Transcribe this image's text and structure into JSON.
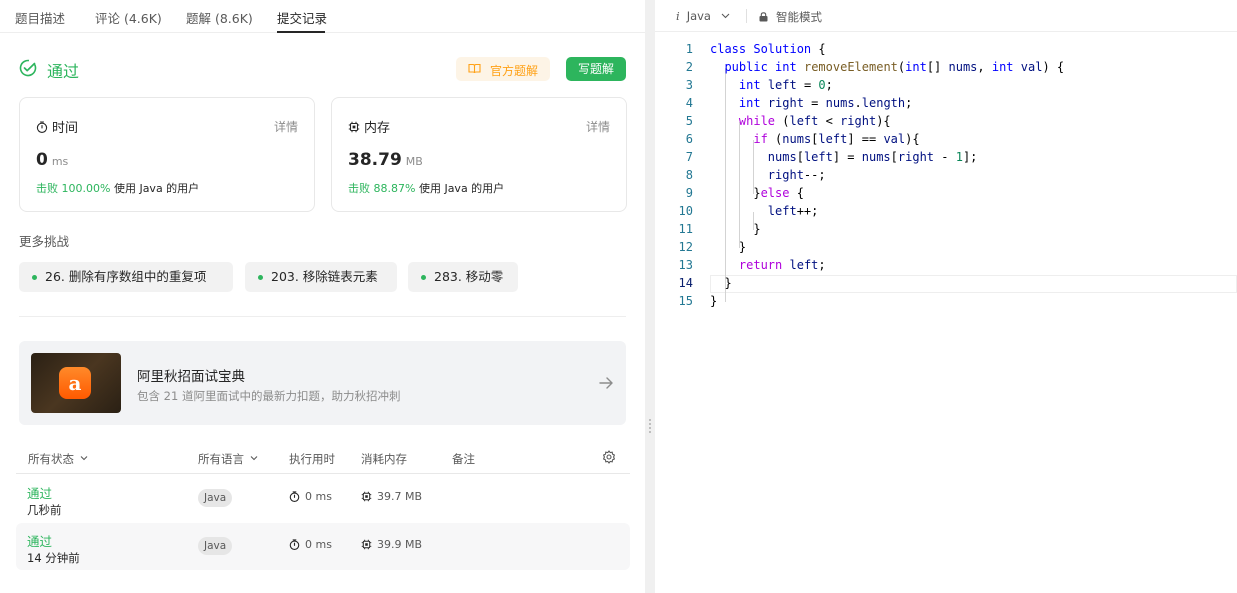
{
  "tabs": [
    {
      "label": "题目描述"
    },
    {
      "label": "评论 (4.6K)"
    },
    {
      "label": "题解 (8.6K)"
    },
    {
      "label": "提交记录",
      "active": true
    }
  ],
  "status": {
    "text": "通过",
    "color": "#2db55d"
  },
  "buttons": {
    "official_solution": "官方题解",
    "write_solution": "写题解"
  },
  "runtime": {
    "title": "时间",
    "detail": "详情",
    "value": "0",
    "unit": "ms",
    "beat_prefix": "击败",
    "beat_pct": "100.00%",
    "beat_suffix": "使用 Java 的用户"
  },
  "memory": {
    "title": "内存",
    "detail": "详情",
    "value": "38.79",
    "unit": "MB",
    "beat_prefix": "击败",
    "beat_pct": "88.87%",
    "beat_suffix": "使用 Java 的用户"
  },
  "more": {
    "title": "更多挑战",
    "items": [
      {
        "label": "26. 删除有序数组中的重复项"
      },
      {
        "label": "203. 移除链表元素"
      },
      {
        "label": "283. 移动零"
      }
    ]
  },
  "banner": {
    "logo_text": "a",
    "title": "阿里秋招面试宝典",
    "subtitle": "包含 21 道阿里面试中的最新力扣题，助力秋招冲刺"
  },
  "table": {
    "headers": {
      "status": "所有状态",
      "language": "所有语言",
      "runtime": "执行用时",
      "memory": "消耗内存",
      "notes": "备注"
    },
    "rows": [
      {
        "status": "通过",
        "time": "几秒前",
        "language": "Java",
        "runtime": "0 ms",
        "memory": "39.7 MB"
      },
      {
        "status": "通过",
        "time": "14 分钟前",
        "language": "Java",
        "runtime": "0 ms",
        "memory": "39.9 MB"
      }
    ]
  },
  "editor": {
    "language": "Java",
    "language_icon": "i",
    "mode": "智能模式",
    "line_numbers": [
      "1",
      "2",
      "3",
      "4",
      "5",
      "6",
      "7",
      "8",
      "9",
      "10",
      "11",
      "12",
      "13",
      "14",
      "15"
    ],
    "current_line": 14
  }
}
